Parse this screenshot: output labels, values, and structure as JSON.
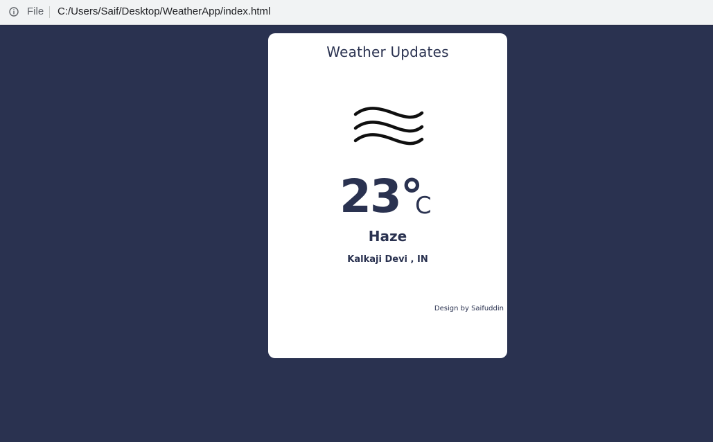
{
  "browser": {
    "scheme_label": "File",
    "url": "C:/Users/Saif/Desktop/WeatherApp/index.html",
    "icon": "info-icon"
  },
  "colors": {
    "page_background": "#2a3250",
    "card_background": "#ffffff",
    "text": "#2a3250"
  },
  "weather": {
    "title": "Weather Updates",
    "icon": "haze-icon",
    "temperature": "23°",
    "unit": "C",
    "condition": "Haze",
    "location": "Kalkaji Devi , IN",
    "credit": "Design by Saifuddin"
  }
}
